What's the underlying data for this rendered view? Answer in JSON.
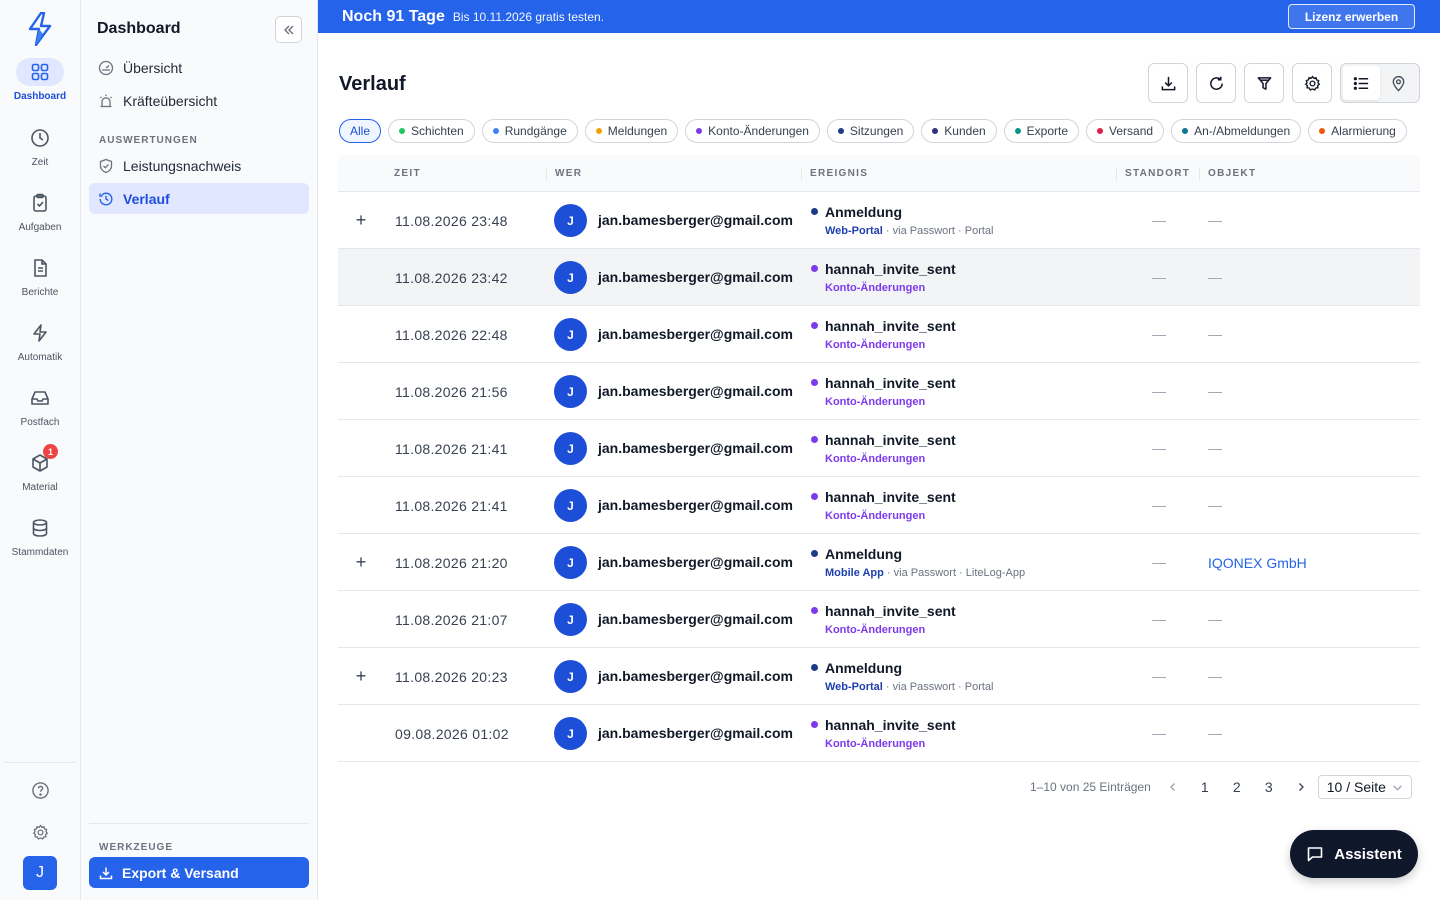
{
  "rail": {
    "items": [
      {
        "label": "Dashboard",
        "icon": "grid-icon",
        "active": true
      },
      {
        "label": "Zeit",
        "icon": "clock-icon"
      },
      {
        "label": "Aufgaben",
        "icon": "clipboard-icon"
      },
      {
        "label": "Berichte",
        "icon": "document-icon"
      },
      {
        "label": "Automatik",
        "icon": "bolt-icon"
      },
      {
        "label": "Postfach",
        "icon": "inbox-icon"
      },
      {
        "label": "Material",
        "icon": "box-icon",
        "badge": "1"
      },
      {
        "label": "Stammdaten",
        "icon": "database-icon"
      }
    ],
    "avatar": "J"
  },
  "sidebar": {
    "title": "Dashboard",
    "items": [
      {
        "label": "Übersicht"
      },
      {
        "label": "Kräfteübersicht"
      }
    ],
    "section_auswertungen": "AUSWERTUNGEN",
    "auswertungen": [
      {
        "label": "Leistungsnachweis"
      },
      {
        "label": "Verlauf"
      }
    ],
    "section_werkzeuge": "WERKZEUGE",
    "export_label": "Export & Versand"
  },
  "banner": {
    "headline": "Noch 91 Tage",
    "sub": "Bis 10.11.2026 gratis testen.",
    "button": "Lizenz erwerben"
  },
  "page": {
    "title": "Verlauf"
  },
  "filters": [
    {
      "label": "Alle",
      "active": true
    },
    {
      "label": "Schichten",
      "color": "#22c55e"
    },
    {
      "label": "Rundgänge",
      "color": "#3b82f6"
    },
    {
      "label": "Meldungen",
      "color": "#f59e0b"
    },
    {
      "label": "Konto-Änderungen",
      "color": "#7c3aed"
    },
    {
      "label": "Sitzungen",
      "color": "#1e3a8a"
    },
    {
      "label": "Kunden",
      "color": "#312e81"
    },
    {
      "label": "Exporte",
      "color": "#0d9488"
    },
    {
      "label": "Versand",
      "color": "#e11d48"
    },
    {
      "label": "An-/Abmeldungen",
      "color": "#0e7490"
    },
    {
      "label": "Alarmierung",
      "color": "#ea580c"
    }
  ],
  "table": {
    "headers": {
      "zeit": "ZEIT",
      "wer": "WER",
      "ereignis": "EREIGNIS",
      "standort": "STANDORT",
      "objekt": "OBJEKT"
    },
    "rows": [
      {
        "expand": "+",
        "time": "11.08.2026 23:48",
        "avatar": "J",
        "who": "jan.bamesberger@gmail.com",
        "event": "Anmeldung",
        "dot": "#1e3a8a",
        "category": "Web-Portal",
        "cat_color": "#1e40af",
        "detail": " · via Passwort · Portal",
        "standort": "—",
        "objekt": "—"
      },
      {
        "expand": "",
        "time": "11.08.2026 23:42",
        "avatar": "J",
        "who": "jan.bamesberger@gmail.com",
        "event": "hannah_invite_sent",
        "dot": "#7c3aed",
        "category": "Konto-Änderungen",
        "cat_color": "#7c3aed",
        "detail": "",
        "standort": "—",
        "objekt": "—",
        "hover": true
      },
      {
        "expand": "",
        "time": "11.08.2026 22:48",
        "avatar": "J",
        "who": "jan.bamesberger@gmail.com",
        "event": "hannah_invite_sent",
        "dot": "#7c3aed",
        "category": "Konto-Änderungen",
        "cat_color": "#7c3aed",
        "detail": "",
        "standort": "—",
        "objekt": "—"
      },
      {
        "expand": "",
        "time": "11.08.2026 21:56",
        "avatar": "J",
        "who": "jan.bamesberger@gmail.com",
        "event": "hannah_invite_sent",
        "dot": "#7c3aed",
        "category": "Konto-Änderungen",
        "cat_color": "#7c3aed",
        "detail": "",
        "standort": "—",
        "objekt": "—"
      },
      {
        "expand": "",
        "time": "11.08.2026 21:41",
        "avatar": "J",
        "who": "jan.bamesberger@gmail.com",
        "event": "hannah_invite_sent",
        "dot": "#7c3aed",
        "category": "Konto-Änderungen",
        "cat_color": "#7c3aed",
        "detail": "",
        "standort": "—",
        "objekt": "—"
      },
      {
        "expand": "",
        "time": "11.08.2026 21:41",
        "avatar": "J",
        "who": "jan.bamesberger@gmail.com",
        "event": "hannah_invite_sent",
        "dot": "#7c3aed",
        "category": "Konto-Änderungen",
        "cat_color": "#7c3aed",
        "detail": "",
        "standort": "—",
        "objekt": "—"
      },
      {
        "expand": "+",
        "time": "11.08.2026 21:20",
        "avatar": "J",
        "who": "jan.bamesberger@gmail.com",
        "event": "Anmeldung",
        "dot": "#1e3a8a",
        "category": "Mobile App",
        "cat_color": "#1e40af",
        "detail": " · via Passwort · LiteLog-App",
        "standort": "—",
        "objekt": "IQONEX GmbH",
        "objekt_link": true
      },
      {
        "expand": "",
        "time": "11.08.2026 21:07",
        "avatar": "J",
        "who": "jan.bamesberger@gmail.com",
        "event": "hannah_invite_sent",
        "dot": "#7c3aed",
        "category": "Konto-Änderungen",
        "cat_color": "#7c3aed",
        "detail": "",
        "standort": "—",
        "objekt": "—"
      },
      {
        "expand": "+",
        "time": "11.08.2026 20:23",
        "avatar": "J",
        "who": "jan.bamesberger@gmail.com",
        "event": "Anmeldung",
        "dot": "#1e3a8a",
        "category": "Web-Portal",
        "cat_color": "#1e40af",
        "detail": " · via Passwort · Portal",
        "standort": "—",
        "objekt": "—"
      },
      {
        "expand": "",
        "time": "09.08.2026 01:02",
        "avatar": "J",
        "who": "jan.bamesberger@gmail.com",
        "event": "hannah_invite_sent",
        "dot": "#7c3aed",
        "category": "Konto-Änderungen",
        "cat_color": "#7c3aed",
        "detail": "",
        "standort": "—",
        "objekt": "—"
      }
    ]
  },
  "pagination": {
    "summary": "1–10 von 25 Einträgen",
    "pages": [
      "1",
      "2",
      "3"
    ],
    "per_page": "10 / Seite"
  },
  "assistant": {
    "label": "Assistent"
  }
}
